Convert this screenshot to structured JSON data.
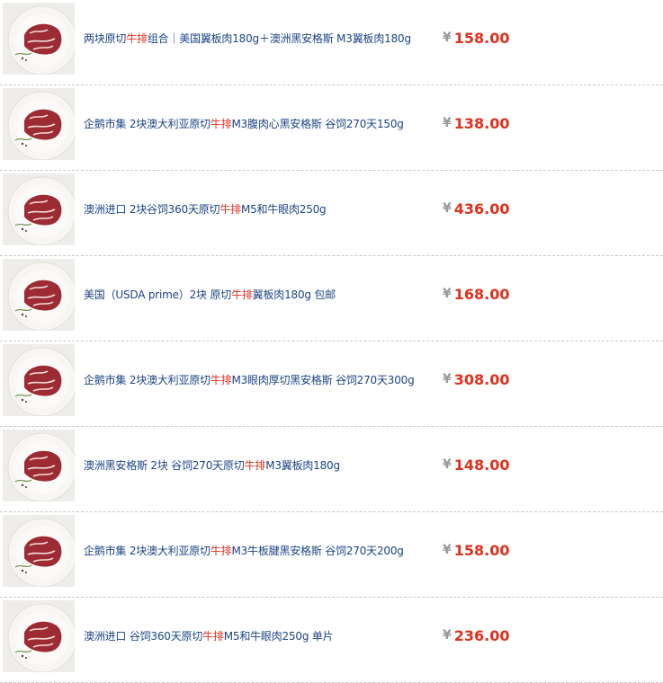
{
  "colors": {
    "title": "#1c4484",
    "highlight": "#e0301e",
    "price": "#e0301e",
    "currency": "#9a9a9a"
  },
  "products": [
    {
      "title_pre": "两块原切",
      "title_hl": "牛排",
      "title_post": "组合｜美国翼板肉180g＋澳洲黑安格斯 M3翼板肉180g",
      "currency": "¥",
      "price": "158.00",
      "image_icon": "steak-photo"
    },
    {
      "title_pre": "企鹅市集 2块澳大利亚原切",
      "title_hl": "牛排",
      "title_post": " M3腹肉心黑安格斯 谷饲270天150g",
      "currency": "¥",
      "price": "138.00",
      "image_icon": "steak-photo"
    },
    {
      "title_pre": "澳洲进口 2块谷饲360天原切",
      "title_hl": "牛排",
      "title_post": " M5和牛眼肉250g",
      "currency": "¥",
      "price": "436.00",
      "image_icon": "steak-photo"
    },
    {
      "title_pre": "美国（USDA prime）2块 原切",
      "title_hl": "牛排",
      "title_post": " 翼板肉180g 包邮",
      "currency": "¥",
      "price": "168.00",
      "image_icon": "steak-photo"
    },
    {
      "title_pre": "企鹅市集 2块澳大利亚原切",
      "title_hl": "牛排",
      "title_post": "M3眼肉厚切黑安格斯 谷饲270天300g",
      "currency": "¥",
      "price": "308.00",
      "image_icon": "steak-photo"
    },
    {
      "title_pre": "澳洲黑安格斯 2块 谷饲270天原切",
      "title_hl": "牛排",
      "title_post": " M3翼板肉180g",
      "currency": "¥",
      "price": "148.00",
      "image_icon": "steak-photo"
    },
    {
      "title_pre": "企鹅市集 2块澳大利亚原切",
      "title_hl": "牛排",
      "title_post": " M3牛板腱黑安格斯 谷饲270天200g",
      "currency": "¥",
      "price": "158.00",
      "image_icon": "steak-photo"
    },
    {
      "title_pre": "澳洲进口 谷饲360天原切",
      "title_hl": "牛排",
      "title_post": " M5和牛眼肉250g 单片",
      "currency": "¥",
      "price": "236.00",
      "image_icon": "steak-photo"
    }
  ]
}
